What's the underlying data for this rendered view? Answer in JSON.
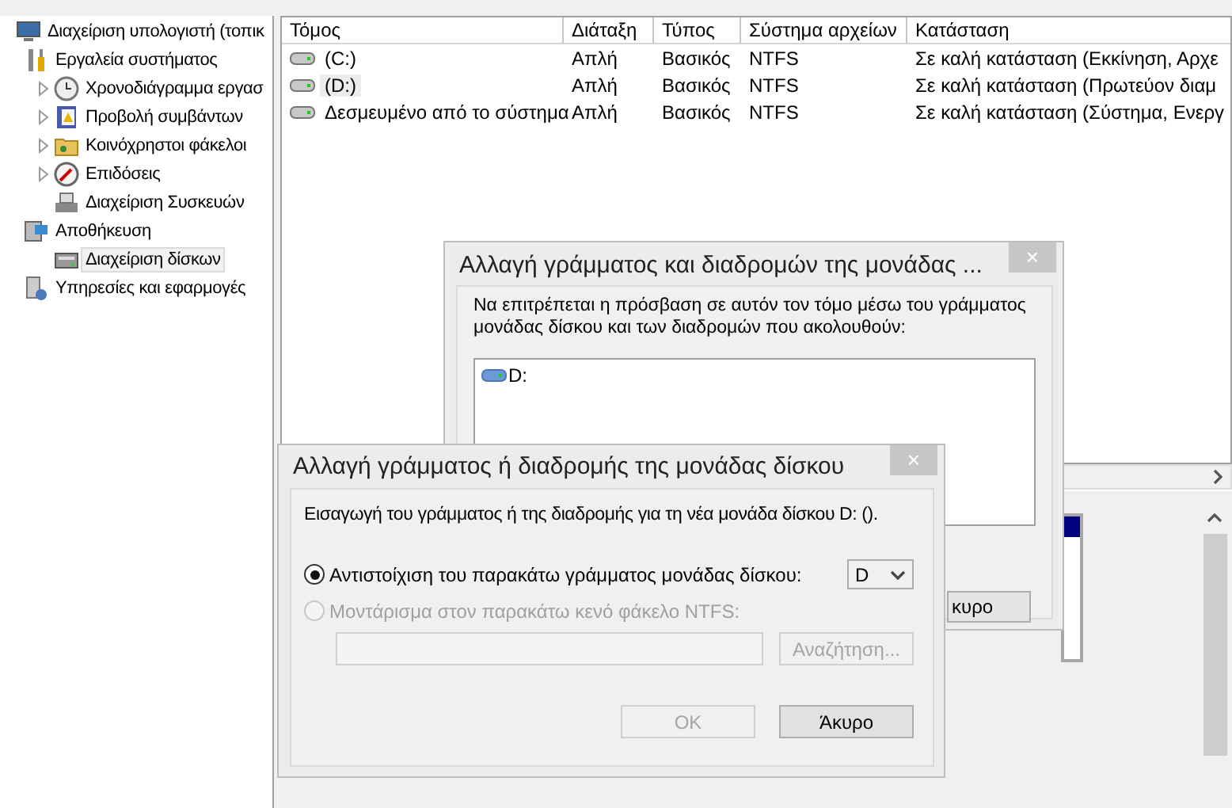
{
  "tree": [
    {
      "label": "Διαχείριση υπολογιστή (τοπικ",
      "kind": "computer",
      "expanded": true,
      "selected": false,
      "children": [
        {
          "label": "Εργαλεία συστήματος",
          "kind": "tools",
          "expanded": true,
          "selected": false,
          "children": [
            {
              "label": "Χρονοδιάγραμμα εργασ",
              "kind": "clock",
              "expanded": false,
              "selected": false
            },
            {
              "label": "Προβολή συμβάντων",
              "kind": "log",
              "expanded": false,
              "selected": false
            },
            {
              "label": "Κοινόχρηστοι φάκελοι",
              "kind": "folder",
              "expanded": false,
              "selected": false
            },
            {
              "label": "Επιδόσεις",
              "kind": "gauge",
              "expanded": false,
              "selected": false
            },
            {
              "label": "Διαχείριση Συσκευών",
              "kind": "devices",
              "selected": false
            }
          ]
        },
        {
          "label": "Αποθήκευση",
          "kind": "storage",
          "expanded": true,
          "selected": false,
          "children": [
            {
              "label": "Διαχείριση δίσκων",
              "kind": "disk",
              "selected": true
            }
          ]
        },
        {
          "label": "Υπηρεσίες και εφαρμογές",
          "kind": "services",
          "selected": false
        }
      ]
    }
  ],
  "table": {
    "columns": [
      "Τόμος",
      "Διάταξη",
      "Τύπος",
      "Σύστημα αρχείων",
      "Κατάσταση"
    ],
    "rows": [
      {
        "cells": [
          "(C:)",
          "Απλή",
          "Βασικός",
          "NTFS",
          "Σε καλή κατάσταση (Εκκίνηση, Αρχε"
        ],
        "selected": false
      },
      {
        "cells": [
          "(D:)",
          "Απλή",
          "Βασικός",
          "NTFS",
          "Σε καλή κατάσταση (Πρωτεύον διαμ"
        ],
        "selected": true
      },
      {
        "cells": [
          "Δεσμευμένο από το σύστημα",
          "Απλή",
          "Βασικός",
          "NTFS",
          "Σε καλή κατάσταση (Σύστημα, Ενεργ"
        ],
        "selected": false
      }
    ]
  },
  "back_dialog": {
    "title": "Αλλαγή γράμματος και διαδρομών της μονάδας ...",
    "close": "×",
    "description": "Να επιτρέπεται η πρόσβαση σε αυτόν τον τόμο μέσω του γράμματος μονάδας δίσκου και των διαδρομών που ακολουθούν:",
    "paths": [
      "D:"
    ],
    "cancel": "κυρο"
  },
  "dialog": {
    "title": "Αλλαγή γράμματος ή διαδρομής της μονάδας δίσκου",
    "close": "×",
    "description": "Εισαγωγή του γράμματος ή της διαδρομής για τη νέα μονάδα δίσκου D: ().",
    "options": [
      {
        "label": "Αντιστοίχιση του παρακάτω γράμματος μονάδας δίσκου:",
        "selected": true,
        "disabled": false
      },
      {
        "label": "Μοντάρισμα στον παρακάτω κενό φάκελο NTFS:",
        "selected": false,
        "disabled": true
      }
    ],
    "letter": "D",
    "browse": {
      "label": "Αναζήτηση...",
      "disabled": true
    },
    "buttons": [
      {
        "label": "OK",
        "disabled": true
      },
      {
        "label": "Άκυρο",
        "disabled": false
      }
    ]
  }
}
